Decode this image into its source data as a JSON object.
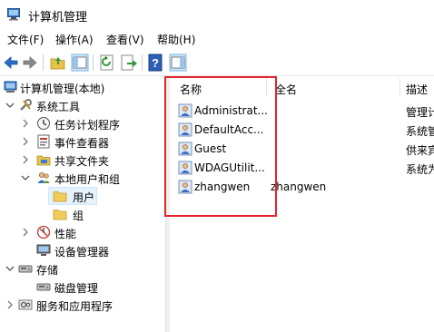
{
  "window": {
    "title": "计算机管理"
  },
  "menu": [
    "文件(F)",
    "操作(A)",
    "查看(V)",
    "帮助(H)"
  ],
  "toolbar": {
    "buttons": [
      "back-icon",
      "forward-icon",
      "up-folder-icon",
      "show-hide-tree-icon",
      "refresh-icon",
      "export-list-icon",
      "help-icon",
      "properties-icon"
    ]
  },
  "tree": {
    "root": "计算机管理(本地)",
    "system_tools": "系统工具",
    "task_scheduler": "任务计划程序",
    "event_viewer": "事件查看器",
    "shared_folders": "共享文件夹",
    "local_users_groups": "本地用户和组",
    "users": "用户",
    "groups": "组",
    "performance": "性能",
    "device_manager": "设备管理器",
    "storage": "存储",
    "disk_management": "磁盘管理",
    "services_apps": "服务和应用程序"
  },
  "list": {
    "columns": {
      "name": "名称",
      "fullname": "全名",
      "description": "描述"
    },
    "rows": [
      {
        "name": "Administrat...",
        "fullname": "",
        "description": "管理计"
      },
      {
        "name": "DefaultAcc...",
        "fullname": "",
        "description": "系统管"
      },
      {
        "name": "Guest",
        "fullname": "",
        "description": "供来宾"
      },
      {
        "name": "WDAGUtilit...",
        "fullname": "",
        "description": "系统为"
      },
      {
        "name": "zhangwen",
        "fullname": "zhangwen",
        "description": ""
      }
    ]
  },
  "colors": {
    "highlight": "#e0262b",
    "selection": "#e5f1fb"
  }
}
